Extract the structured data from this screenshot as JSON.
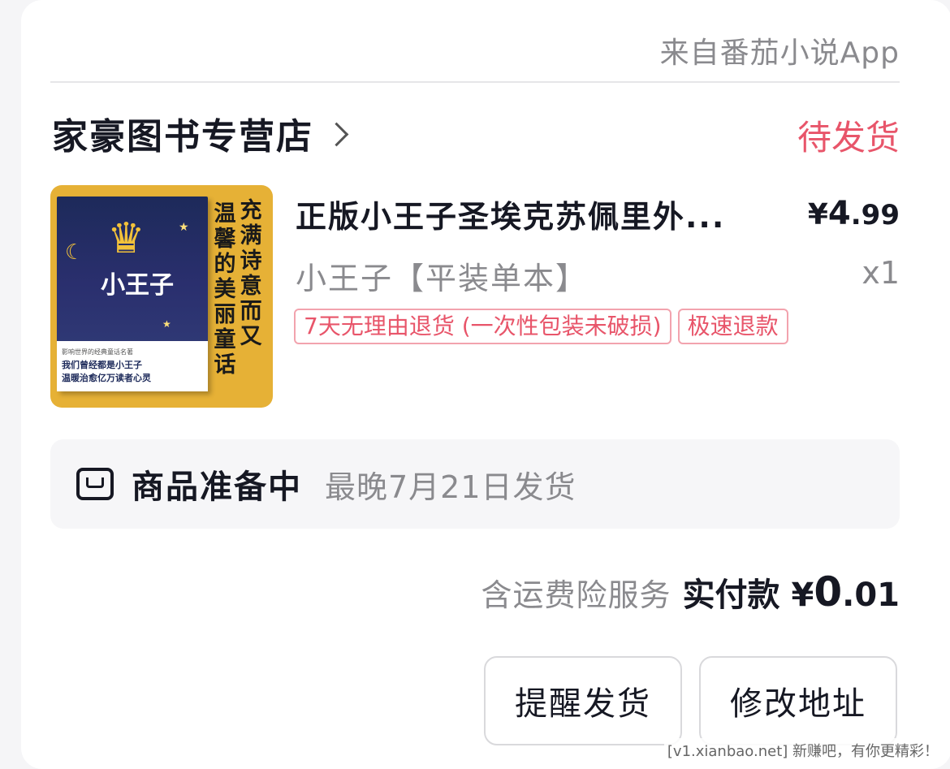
{
  "source_label": "来自番茄小说App",
  "store": {
    "name": "家豪图书专营店",
    "status": "待发货"
  },
  "product": {
    "title": "正版小王子圣埃克苏佩里外...",
    "price_symbol": "¥",
    "price_int": "4",
    "price_dec": ".99",
    "variant": "小王子【平装单本】",
    "quantity": "x1",
    "tags": [
      "7天无理由退货 (一次性包装未破损)",
      "极速退款"
    ],
    "cover": {
      "title": "小王子",
      "slogan_col1": "充满诗意而又",
      "slogan_col2": "温馨的美丽童话",
      "band_line1": "我们曾经都是小王子",
      "band_line2": "温暖治愈亿万读者心灵",
      "band_top": "影响世界的经典童话名著"
    }
  },
  "shipping": {
    "title": "商品准备中",
    "date": "最晚7月21日发货"
  },
  "payment": {
    "note": "含运费险服务",
    "label": "实付款",
    "symbol": "¥",
    "amount_int": "0",
    "amount_dec": ".01"
  },
  "buttons": {
    "remind": "提醒发货",
    "address": "修改地址"
  },
  "watermark": "[v1.xianbao.net] 新赚吧，有你更精彩！",
  "colors": {
    "status": "#e8556a",
    "cover_bg": "#e6b136",
    "text": "#161823",
    "muted": "#8a8a8e"
  }
}
